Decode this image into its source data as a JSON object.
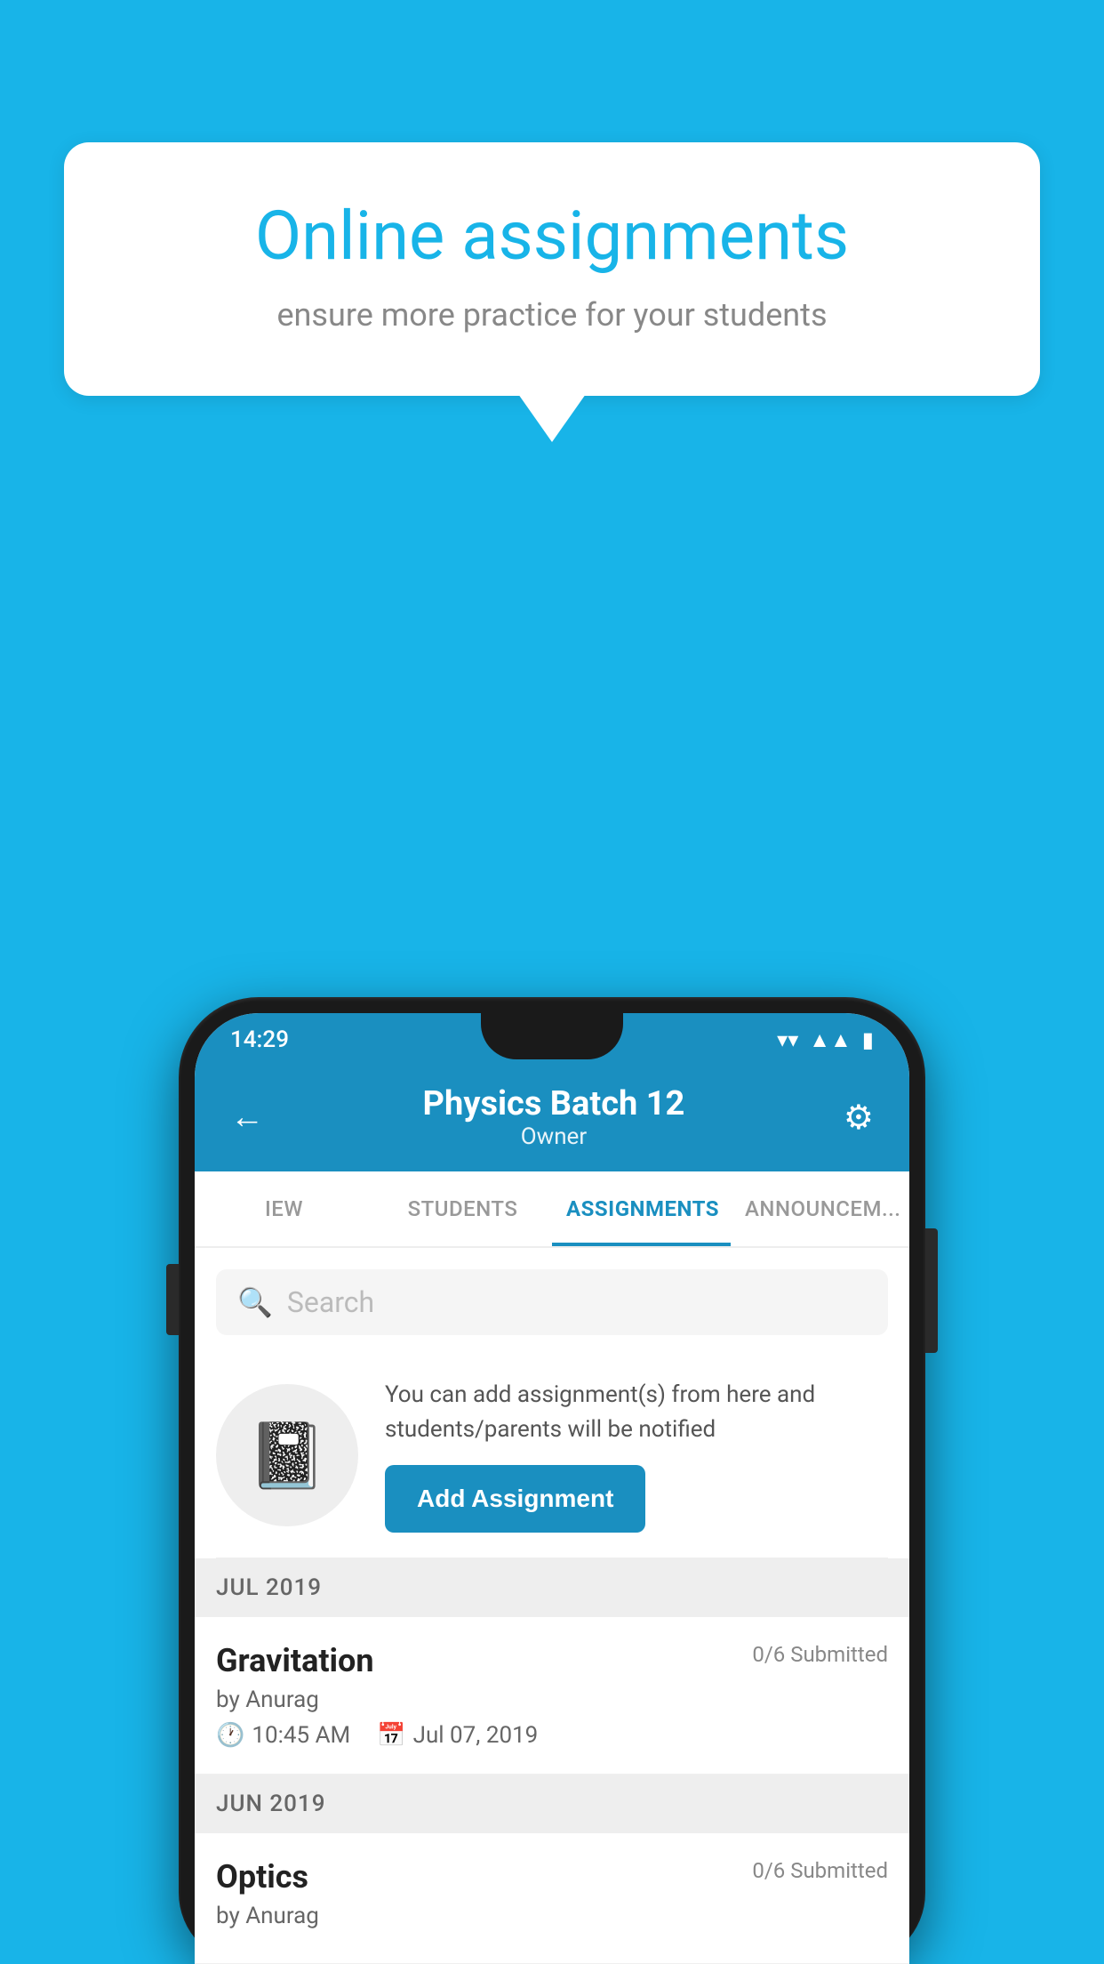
{
  "background": {
    "color": "#18b4e8"
  },
  "speech_bubble": {
    "title": "Online assignments",
    "subtitle": "ensure more practice for your students"
  },
  "status_bar": {
    "time": "14:29",
    "wifi": "▼",
    "signal": "▲",
    "battery": "▮"
  },
  "app_header": {
    "back_label": "←",
    "title": "Physics Batch 12",
    "subtitle": "Owner",
    "settings_label": "⚙"
  },
  "tabs": [
    {
      "label": "IEW",
      "active": false
    },
    {
      "label": "STUDENTS",
      "active": false
    },
    {
      "label": "ASSIGNMENTS",
      "active": true
    },
    {
      "label": "ANNOUNCEM...",
      "active": false
    }
  ],
  "search": {
    "placeholder": "Search",
    "icon": "🔍"
  },
  "promo": {
    "description": "You can add assignment(s) from here and students/parents will be notified",
    "add_button_label": "Add Assignment"
  },
  "sections": [
    {
      "label": "JUL 2019",
      "assignments": [
        {
          "name": "Gravitation",
          "submitted": "0/6 Submitted",
          "author": "by Anurag",
          "time": "10:45 AM",
          "date": "Jul 07, 2019"
        }
      ]
    },
    {
      "label": "JUN 2019",
      "assignments": [
        {
          "name": "Optics",
          "submitted": "0/6 Submitted",
          "author": "by Anurag",
          "time": "",
          "date": ""
        }
      ]
    }
  ]
}
